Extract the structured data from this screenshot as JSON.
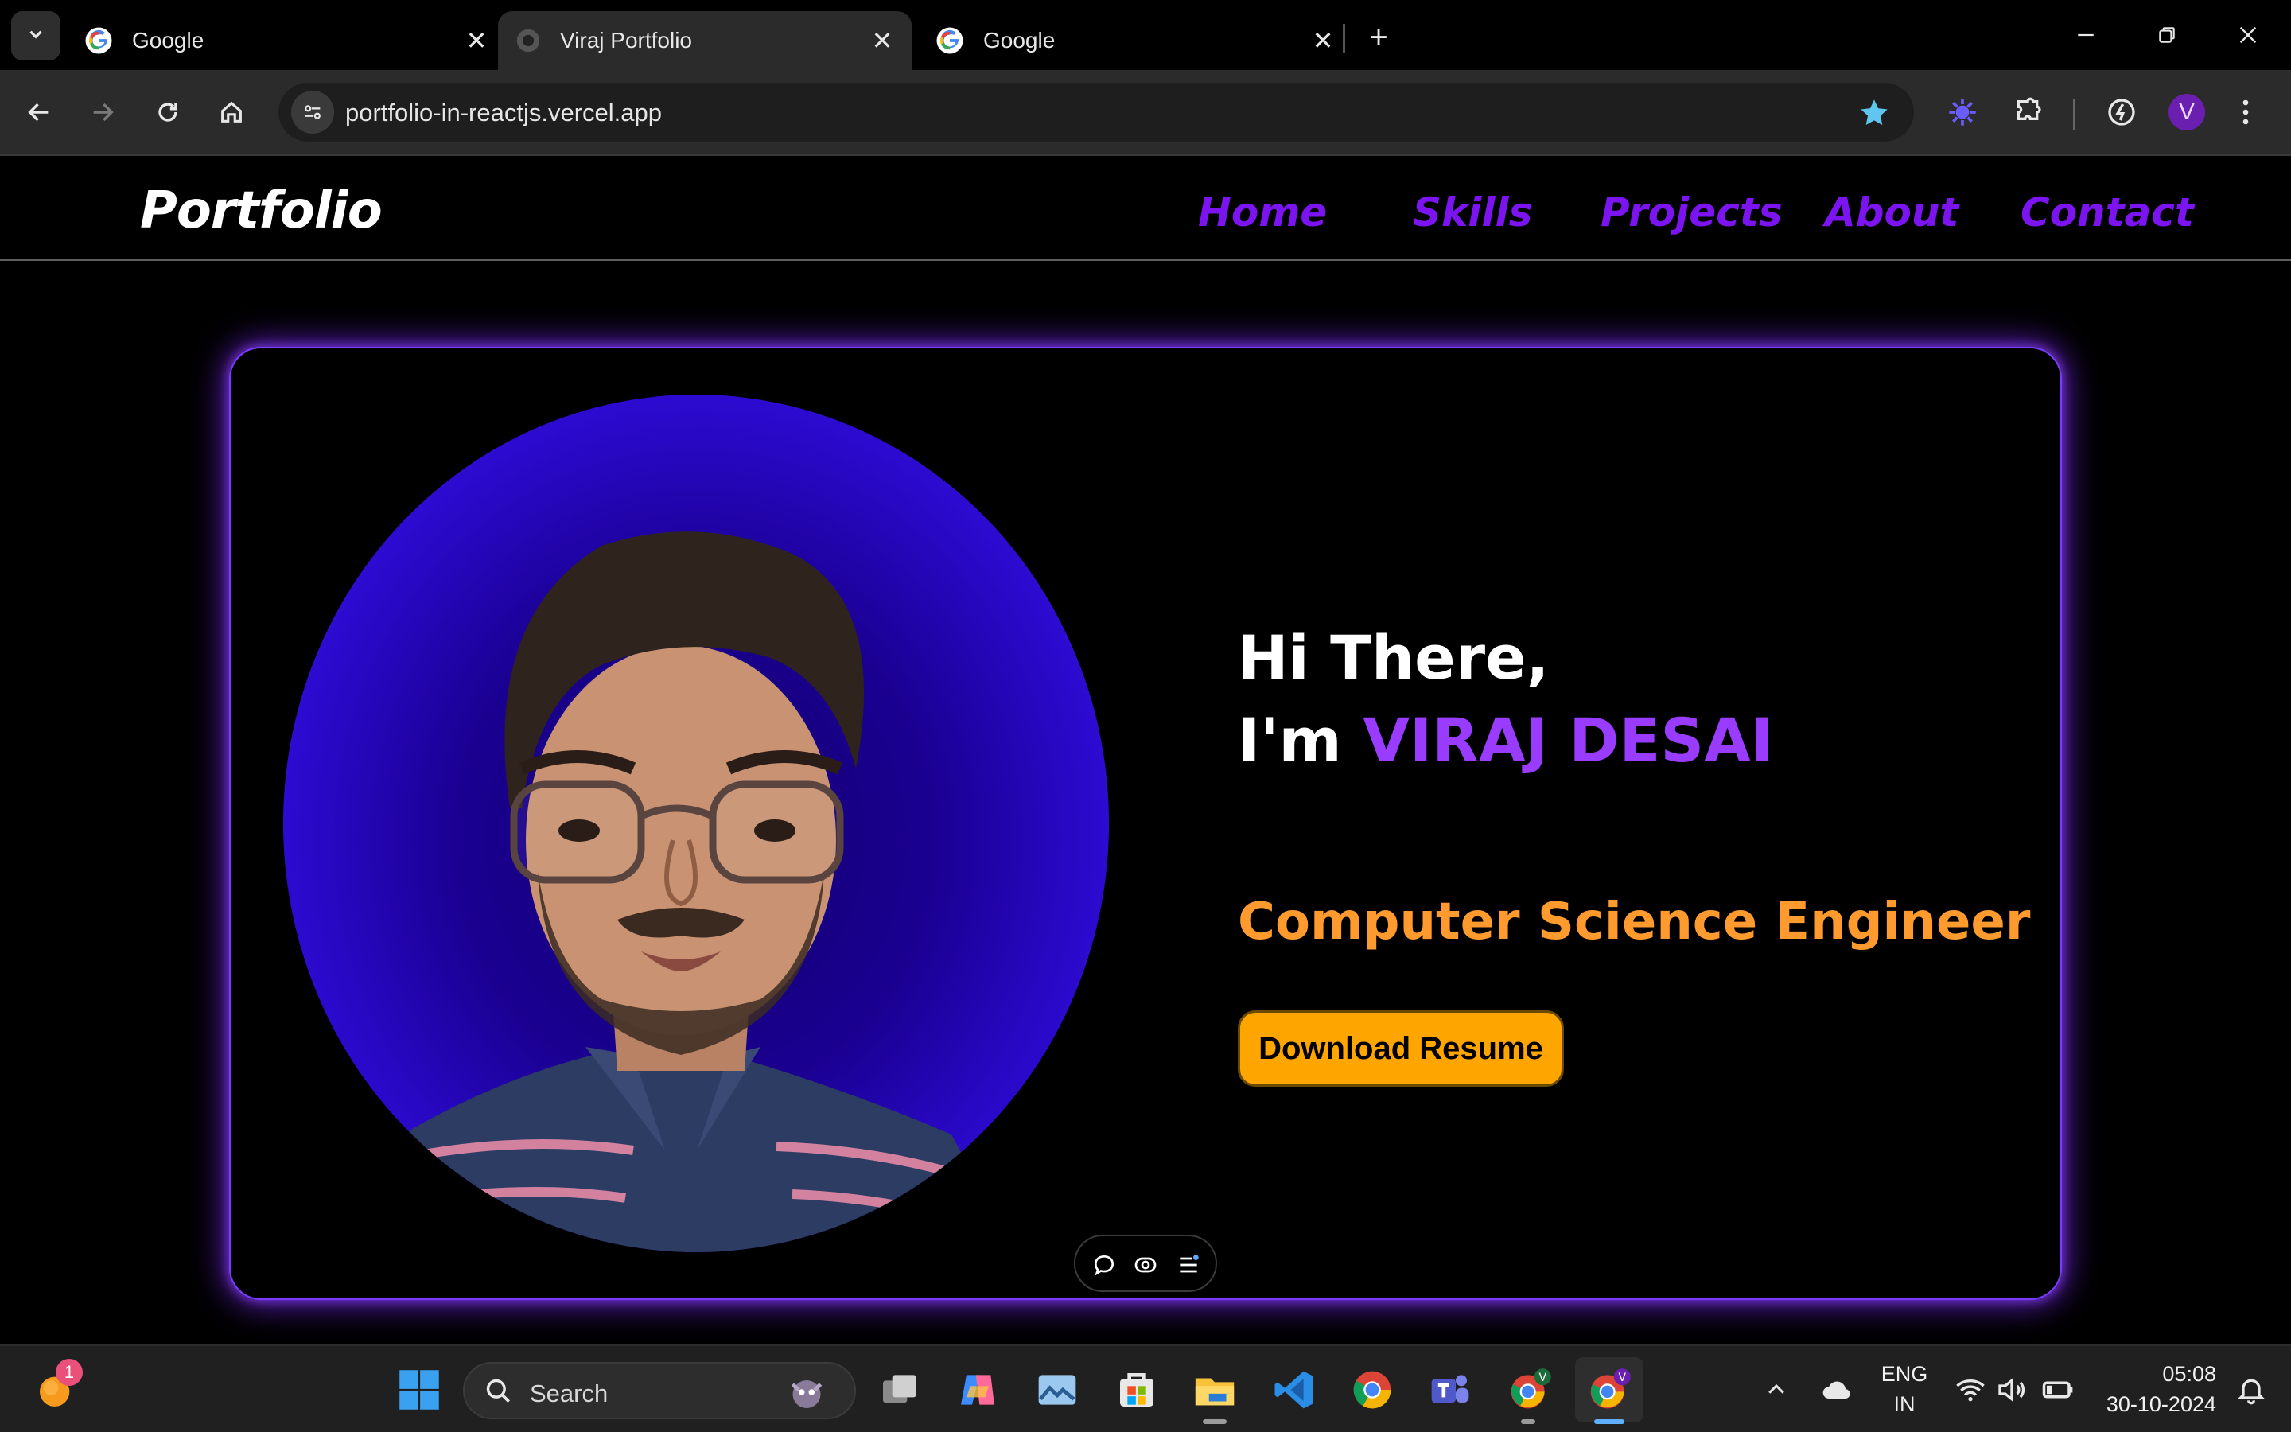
{
  "browser": {
    "tabs": [
      {
        "title": "Google",
        "active": false
      },
      {
        "title": "Viraj Portfolio",
        "active": true
      },
      {
        "title": "Google",
        "active": false
      }
    ],
    "url": "portfolio-in-reactjs.vercel.app",
    "profile_initial": "V"
  },
  "site": {
    "brand": "Portfolio",
    "nav": [
      "Home",
      "Skills",
      "Projects",
      "About",
      "Contact"
    ],
    "hero": {
      "greeting_line1": "Hi There,",
      "greeting_prefix": "I'm ",
      "name": "VIRAJ DESAI",
      "role": "Computer Science Engineer",
      "button": "Download Resume"
    },
    "colors": {
      "nav_link": "#7b14f0",
      "name": "#9a3cff",
      "role": "#ff9a2e",
      "button": "#ffa500",
      "card_glow": "#7a3cff"
    }
  },
  "taskbar": {
    "search_placeholder": "Search",
    "notification_count": "1",
    "lang_line1": "ENG",
    "lang_line2": "IN",
    "time": "05:08",
    "date": "30-10-2024"
  }
}
